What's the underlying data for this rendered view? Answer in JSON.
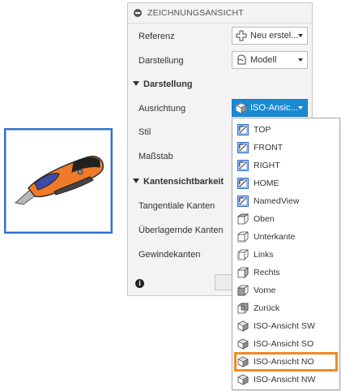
{
  "panel": {
    "title": "ZEICHNUNGSANSICHT",
    "referenz_label": "Referenz",
    "referenz_value": "Neu erstel...",
    "darstellung_label": "Darstellung",
    "darstellung_value": "Modell",
    "section_darstellung": "Darstellung",
    "ausrichtung_label": "Ausrichtung",
    "ausrichtung_value": "ISO-Ansic...",
    "stil_label": "Stil",
    "massstab_label": "Maßstab",
    "section_kanten": "Kantensichtbarkeit",
    "tangentiale_label": "Tangentiale Kanten",
    "ueberlagernde_label": "Überlagernde Kanten",
    "gewinde_label": "Gewindekanten",
    "info_glyph": "i"
  },
  "menu": {
    "items": [
      {
        "label": "TOP",
        "icon": "named-view-icon"
      },
      {
        "label": "FRONT",
        "icon": "named-view-icon"
      },
      {
        "label": "RIGHT",
        "icon": "named-view-icon"
      },
      {
        "label": "HOME",
        "icon": "named-view-icon"
      },
      {
        "label": "NamedView",
        "icon": "named-view-icon"
      },
      {
        "label": "Oben",
        "icon": "cube-top-icon"
      },
      {
        "label": "Unterkante",
        "icon": "cube-bottom-icon"
      },
      {
        "label": "Links",
        "icon": "cube-left-icon"
      },
      {
        "label": "Rechts",
        "icon": "cube-right-icon"
      },
      {
        "label": "Vorne",
        "icon": "cube-front-icon"
      },
      {
        "label": "Zurück",
        "icon": "cube-back-icon"
      },
      {
        "label": "ISO-Ansicht SW",
        "icon": "iso-cube-icon"
      },
      {
        "label": "ISO-Ansicht SO",
        "icon": "iso-cube-icon"
      },
      {
        "label": "ISO-Ansicht NO",
        "icon": "iso-cube-icon",
        "selected": true
      },
      {
        "label": "ISO-Ansicht NW",
        "icon": "iso-cube-icon"
      }
    ]
  },
  "colors": {
    "accent": "#1a8ad4",
    "selection_outline": "#f08a24",
    "thumbnail_border": "#2f6fcf"
  }
}
